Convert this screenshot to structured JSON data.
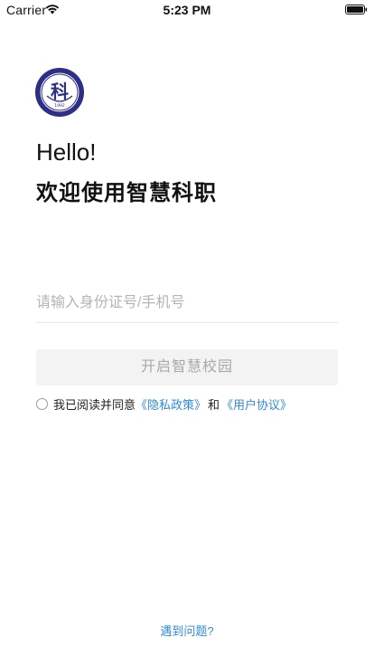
{
  "status_bar": {
    "carrier": "Carrier",
    "time": "5:23 PM"
  },
  "logo": {
    "icon": "school-seal-logo",
    "text": "科",
    "year": "1992",
    "color": "#2d2e86"
  },
  "greeting": {
    "hello": "Hello!",
    "welcome": "欢迎使用智慧科职"
  },
  "login": {
    "id_input_placeholder": "请输入身份证号/手机号",
    "id_input_value": "",
    "submit_label": "开启智慧校园"
  },
  "agreement": {
    "prefix": "我已阅读并同意",
    "privacy_link": "《隐私政策》",
    "and": "和",
    "terms_link": "《用户协议》",
    "checked": false
  },
  "footer": {
    "help_link": "遇到问题?"
  },
  "colors": {
    "link": "#2f8ad8",
    "button_bg": "#f3f3f3",
    "button_text": "#a8a8a8"
  }
}
